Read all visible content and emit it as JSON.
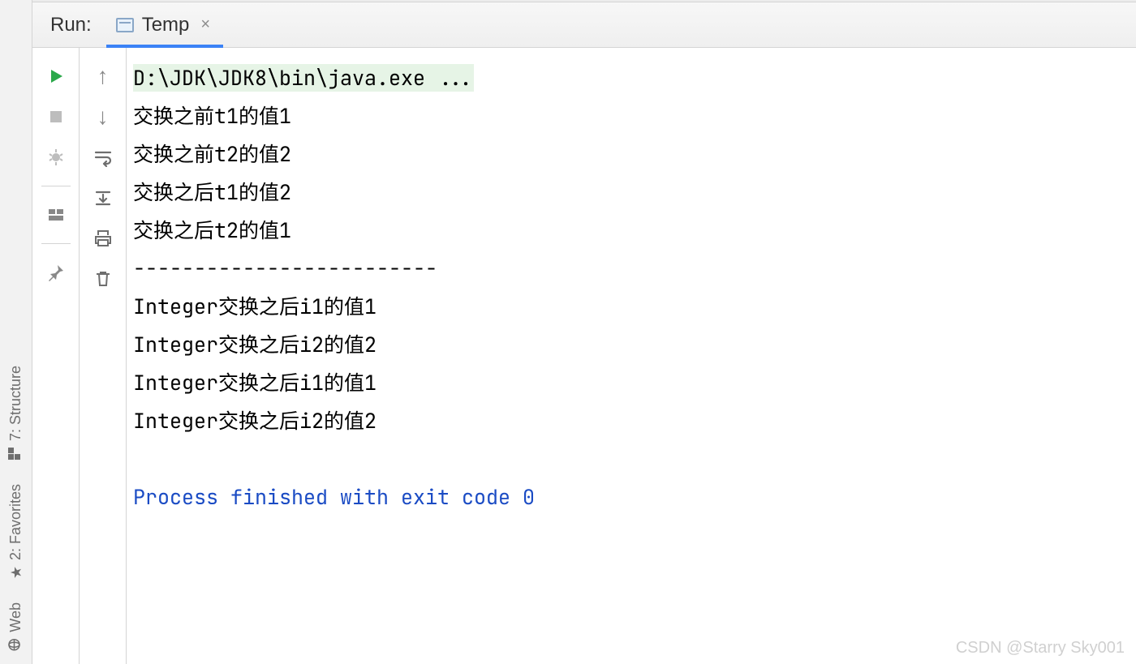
{
  "dock": {
    "structure_label": "7: Structure",
    "favorites_label": "2: Favorites",
    "web_label": "Web"
  },
  "run": {
    "label": "Run:",
    "tab_name": "Temp"
  },
  "console": {
    "cmd": "D:\\JDK\\JDK8\\bin\\java.exe ...",
    "lines": [
      "交换之前t1的值1",
      "交换之前t2的值2",
      "交换之后t1的值2",
      "交换之后t2的值1",
      "-------------------------",
      "Integer交换之后i1的值1",
      "Integer交换之后i2的值2",
      "Integer交换之后i1的值1",
      "Integer交换之后i2的值2"
    ],
    "exit": "Process finished with exit code 0"
  },
  "watermark": "CSDN @Starry Sky001"
}
